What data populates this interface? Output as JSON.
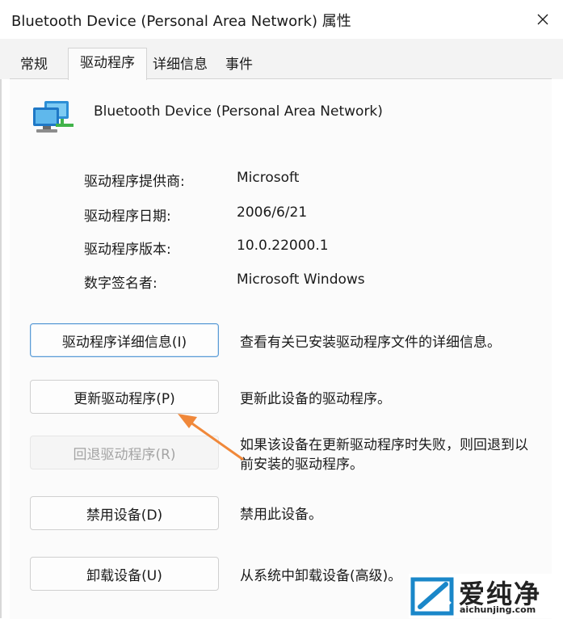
{
  "window": {
    "title": "Bluetooth Device (Personal Area Network) 属性"
  },
  "tabs": [
    {
      "label": "常规",
      "active": false
    },
    {
      "label": "驱动程序",
      "active": true
    },
    {
      "label": "详细信息",
      "active": false
    },
    {
      "label": "事件",
      "active": false
    }
  ],
  "device": {
    "name": "Bluetooth Device (Personal Area Network)",
    "icon": "network-adapter-icon"
  },
  "driver_info": [
    {
      "label": "驱动程序提供商:",
      "value": "Microsoft"
    },
    {
      "label": "驱动程序日期:",
      "value": "2006/6/21"
    },
    {
      "label": "驱动程序版本:",
      "value": "10.0.22000.1"
    },
    {
      "label": "数字签名者:",
      "value": "Microsoft Windows"
    }
  ],
  "actions": [
    {
      "button": "驱动程序详细信息(I)",
      "description": "查看有关已安装驱动程序文件的详细信息。",
      "state": "focused"
    },
    {
      "button": "更新驱动程序(P)",
      "description": "更新此设备的驱动程序。",
      "state": "normal"
    },
    {
      "button": "回退驱动程序(R)",
      "description": "如果该设备在更新驱动程序时失败，则回退到以前安装的驱动程序。",
      "state": "disabled"
    },
    {
      "button": "禁用设备(D)",
      "description": "禁用此设备。",
      "state": "normal"
    },
    {
      "button": "卸载设备(U)",
      "description": "从系统中卸载设备(高级)。",
      "state": "normal"
    }
  ],
  "watermark": {
    "brand": "爱纯净",
    "url": "aichunjing.com"
  },
  "colors": {
    "annotation_arrow": "#f0883a",
    "focus_border": "#5b9bd5",
    "tab_strip": "#f3f3f3"
  }
}
